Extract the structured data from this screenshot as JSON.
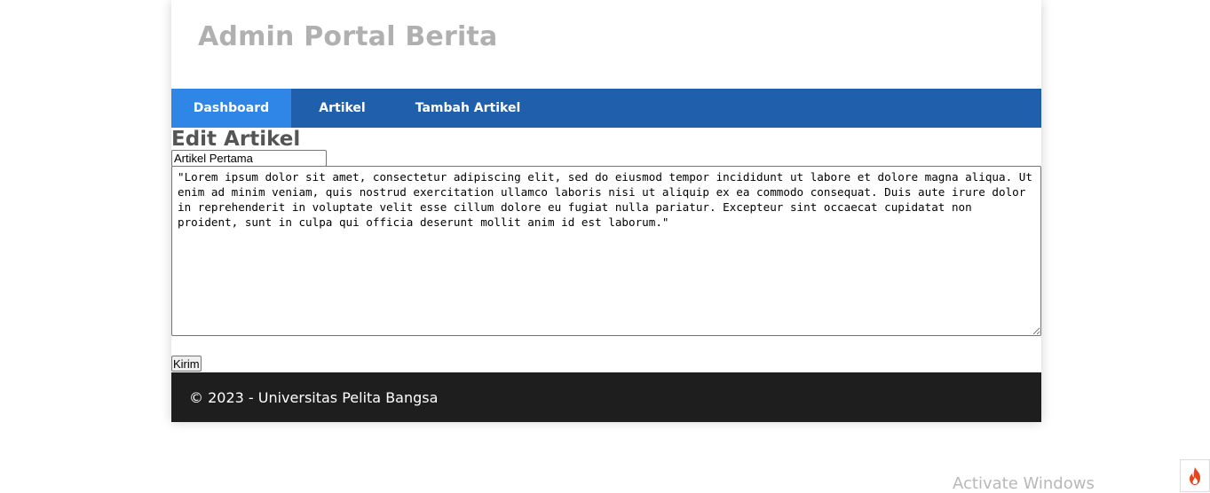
{
  "header": {
    "title": "Admin Portal Berita"
  },
  "nav": {
    "items": [
      {
        "label": "Dashboard",
        "active": true
      },
      {
        "label": "Artikel",
        "active": false
      },
      {
        "label": "Tambah Artikel",
        "active": false
      }
    ]
  },
  "main": {
    "page_title": "Edit Artikel",
    "title_field_value": "Artikel Pertama",
    "content_value": "\"Lorem ipsum dolor sit amet, consectetur adipiscing elit, sed do eiusmod tempor incididunt ut labore et dolore magna aliqua. Ut enim ad minim veniam, quis nostrud exercitation ullamco laboris nisi ut aliquip ex ea commodo consequat. Duis aute irure dolor in reprehenderit in voluptate velit esse cillum dolore eu fugiat nulla pariatur. Excepteur sint occaecat cupidatat non proident, sunt in culpa qui officia deserunt mollit anim id est laborum.\"",
    "submit_label": "Kirim"
  },
  "footer": {
    "text": "© 2023 - Universitas Pelita Bangsa"
  },
  "os": {
    "watermark": "Activate Windows",
    "tray_icon": "codeigniter-flame-icon"
  },
  "colors": {
    "nav_bg": "#1f5fac",
    "nav_active": "#2f86e6",
    "footer_bg": "#1e1e1e",
    "title_color": "#b0b0b0"
  }
}
